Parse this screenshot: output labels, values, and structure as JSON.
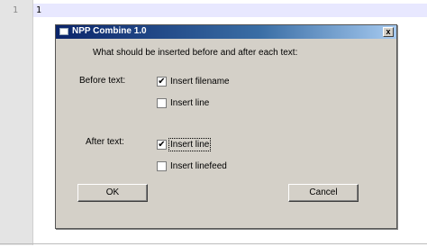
{
  "editor": {
    "line_number": "1",
    "line_text": "1"
  },
  "dialog": {
    "title": "NPP Combine 1.0",
    "close_glyph": "x",
    "prompt": "What should be inserted before and after each text:",
    "before": {
      "label": "Before text:",
      "options": [
        {
          "label": "Insert filename",
          "checked": true
        },
        {
          "label": "Insert line",
          "checked": false
        }
      ]
    },
    "after": {
      "label": "After text:",
      "options": [
        {
          "label": "Insert line",
          "checked": true
        },
        {
          "label": "Insert linefeed",
          "checked": false
        }
      ]
    },
    "ok_label": "OK",
    "cancel_label": "Cancel"
  }
}
